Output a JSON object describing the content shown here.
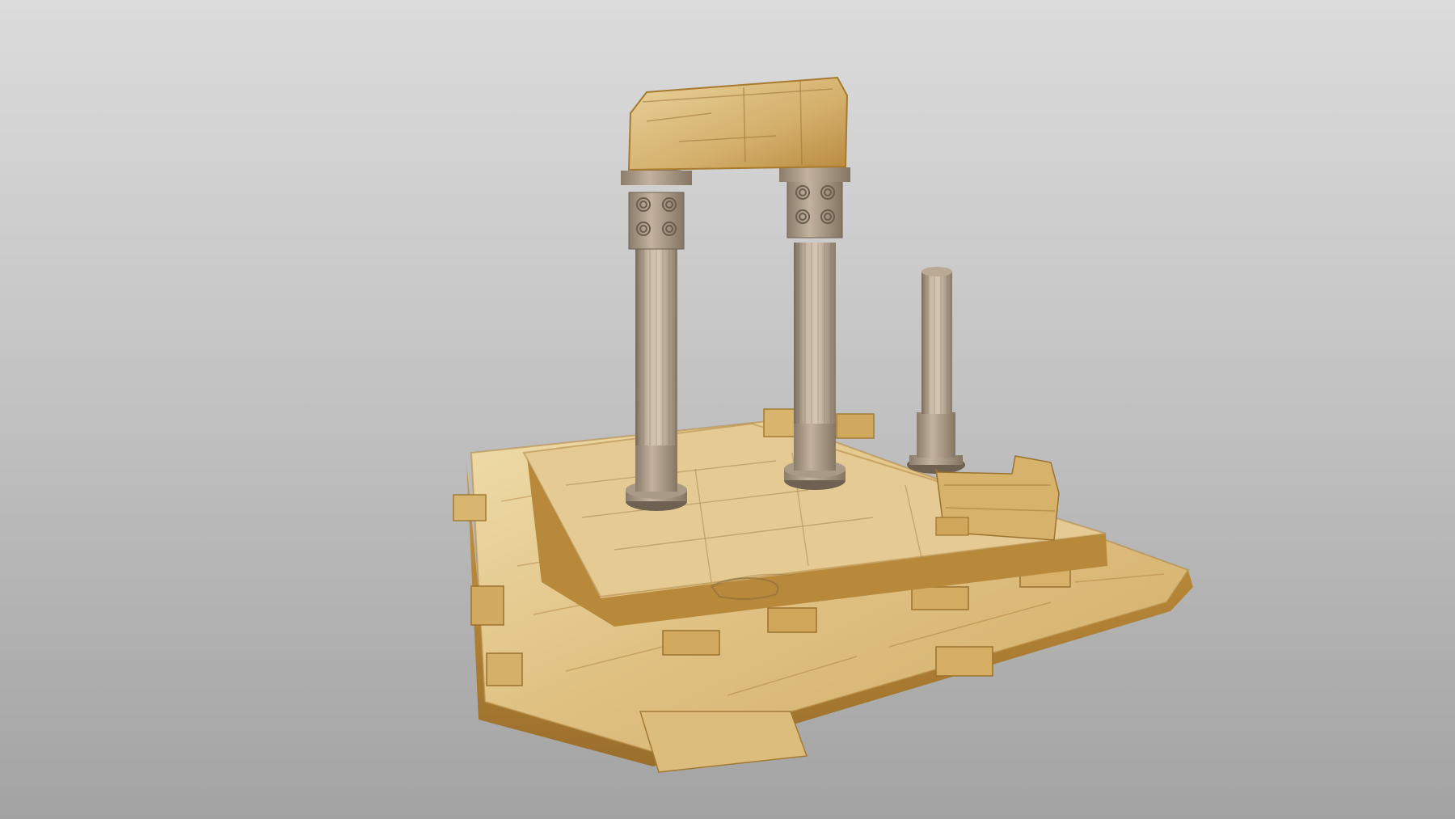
{
  "scene": {
    "subject": "ancient-temple-ruin-3d-model",
    "colors": {
      "background_top": "#dcdcdc",
      "background_bottom": "#a3a3a3",
      "sandstone_light": "#e8cf94",
      "sandstone_mid": "#d1a85c",
      "sandstone_dark": "#9a7433",
      "column_light": "#c9b9a6",
      "column_mid": "#a89884",
      "column_dark": "#6e6152"
    },
    "objects": {
      "intact_columns": 2,
      "broken_columns": 1,
      "lintel_blocks": 1,
      "wall_fragments": 2
    }
  }
}
